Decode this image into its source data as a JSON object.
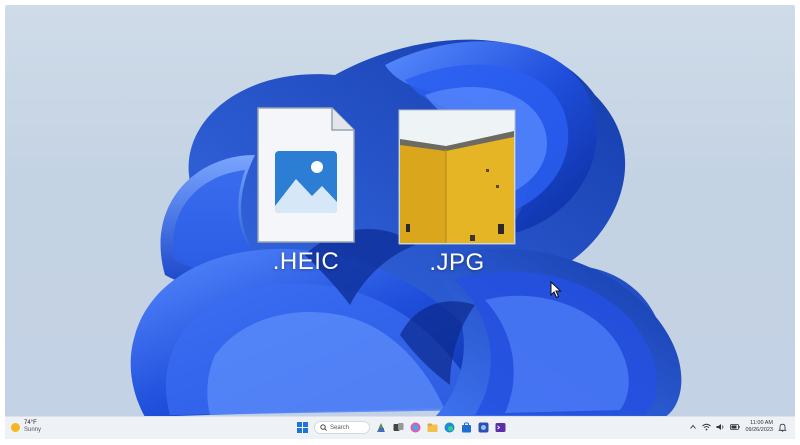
{
  "desktop": {
    "files": [
      {
        "label": ".HEIC",
        "icon": "heic-file-icon"
      },
      {
        "label": ".JPG",
        "icon": "jpg-thumbnail-icon"
      }
    ]
  },
  "taskbar": {
    "weather": {
      "temperature": "74°F",
      "condition": "Sunny"
    },
    "search_label": "Search",
    "tray": {
      "time": "11:00 AM",
      "date": "09/26/2023"
    }
  },
  "colors": {
    "bloom_blue": "#1b4fd6",
    "jpg_yellow": "#e6b526",
    "heic_blue": "#2b7ed3"
  }
}
